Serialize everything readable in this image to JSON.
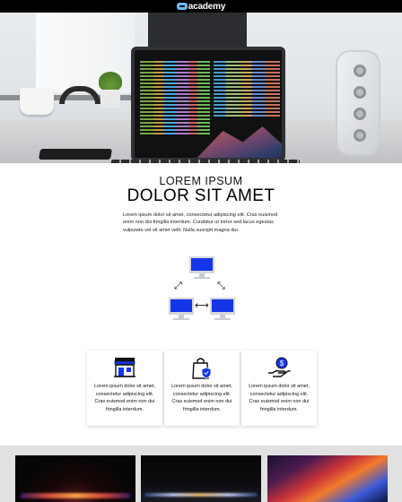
{
  "header": {
    "logo_text": "academy",
    "logo_icon": "academy-logo-icon"
  },
  "hero": {
    "image": "desk-laptop-code-photo"
  },
  "intro": {
    "kicker": "LOREM IPSUM",
    "title": "DOLOR SIT AMET",
    "description": "Lorem ipsum dolor sit amet, consectetur adipiscing elit. Cras euismod enim non dui fringilla interdum. Curabitur ut tortor sed lacus egestas vulputate vel sit amet velit. Nulla suscipit magna dui."
  },
  "diagram": {
    "icon": "network-computers-icon",
    "accent_color": "#1535e8"
  },
  "cards": [
    {
      "icon": "storefront-icon",
      "text": "Lorem ipsum dolor sit amet, consectetur adipiscing elit. Cras euismod enim non dui fringilla interdum."
    },
    {
      "icon": "shopping-bag-shield-icon",
      "text": "Lorem ipsum dolor sit amet, consectetur adipiscing elit. Cras euismod enim non dui fringilla interdum."
    },
    {
      "icon": "hand-coin-icon",
      "text": "Lorem ipsum dolor sit amet, consectetur adipiscing elit. Cras euismod enim non dui fringilla interdum."
    }
  ],
  "gallery": {
    "items": [
      "laptop-glow-dark-image",
      "laptop-edge-light-image",
      "abstract-color-waves-image"
    ]
  },
  "colors": {
    "accent": "#1535e8",
    "topbar": "#000000",
    "logo_blue": "#6fb7f2",
    "gallery_bg": "#e1e1e1"
  }
}
